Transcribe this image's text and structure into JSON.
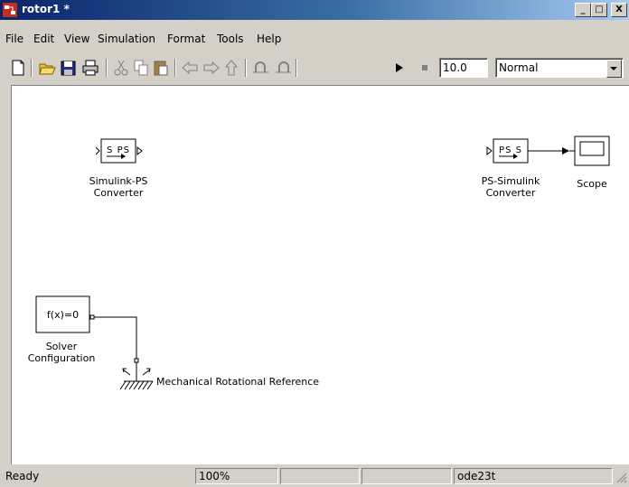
{
  "window": {
    "title": "rotor1 *",
    "minimize_label": "_",
    "maximize_label": "□",
    "close_label": "X"
  },
  "menu": [
    {
      "label": "File"
    },
    {
      "label": "Edit"
    },
    {
      "label": "View"
    },
    {
      "label": "Simulation"
    },
    {
      "label": "Format"
    },
    {
      "label": "Tools"
    },
    {
      "label": "Help"
    }
  ],
  "toolbar": {
    "stop_time": "10.0",
    "sim_mode": "Normal"
  },
  "blocks": {
    "sl_ps": {
      "port_text": "S PS",
      "label_line1": "Simulink-PS",
      "label_line2": "Converter"
    },
    "ps_sl": {
      "port_text": "PS S",
      "label_line1": "PS-Simulink",
      "label_line2": "Converter"
    },
    "scope": {
      "label": "Scope"
    },
    "solver": {
      "text": "f(x)=0",
      "label_line1": "Solver",
      "label_line2": "Configuration"
    },
    "mech_ref": {
      "label": "Mechanical Rotational Reference"
    }
  },
  "status": {
    "state": "Ready",
    "zoom": "100%",
    "solver": "ode23t"
  }
}
